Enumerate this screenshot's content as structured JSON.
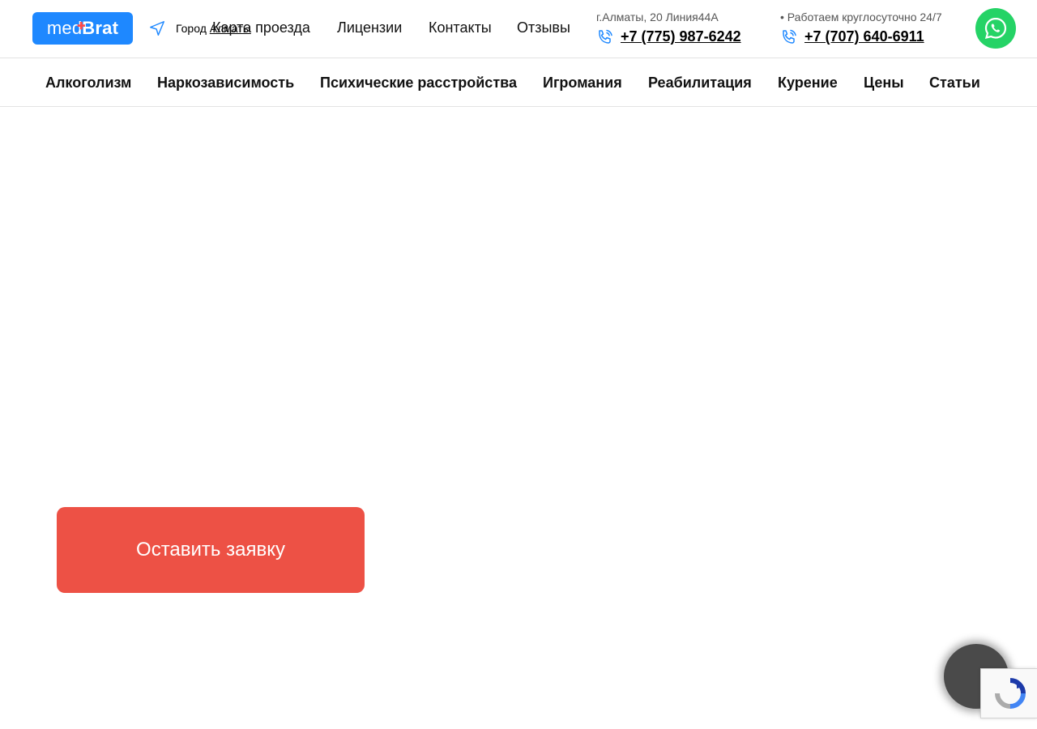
{
  "header": {
    "logo": {
      "part1": "med",
      "part2": "Brat",
      "alt": "medBrat"
    },
    "city": {
      "prefix": "Город",
      "name": "Алматы"
    },
    "top_nav": [
      "Карта проезда",
      "Лицензии",
      "Контакты",
      "Отзывы"
    ],
    "address": "г.Алматы, 20 Линия44А",
    "hours": "• Работаем круглосуточно 24/7",
    "phones": [
      "+7 (775) 987-6242",
      "+7 (707) 640-6911"
    ],
    "icons": {
      "geo": "navigation-arrow-icon",
      "phone": "phone-ringing-icon",
      "whatsapp": "whatsapp-icon"
    }
  },
  "menu": [
    "Алкоголизм",
    "Наркозависимость",
    "Психические расстройства",
    "Игромания",
    "Реабилитация",
    "Курение",
    "Цены",
    "Статьи"
  ],
  "main": {
    "cta_label": "Оставить заявку"
  },
  "colors": {
    "brand_blue": "#1e88ff",
    "cta_red": "#ed5145",
    "whatsapp_green": "#25d366"
  }
}
